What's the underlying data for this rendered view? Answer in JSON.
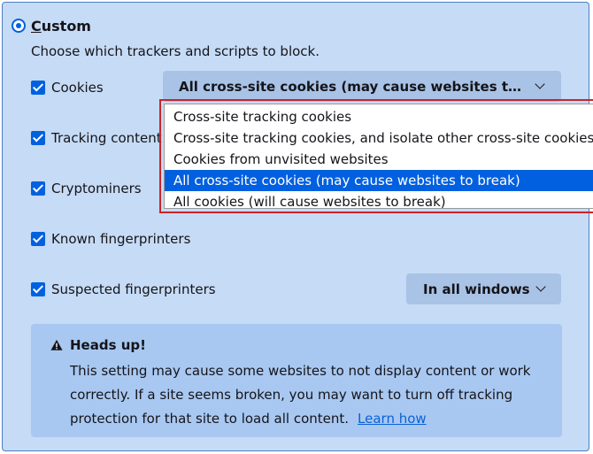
{
  "custom": {
    "title": "Custom",
    "description": "Choose which trackers and scripts to block."
  },
  "rows": [
    {
      "label": "Cookies",
      "checked": true
    },
    {
      "label": "Tracking content",
      "checked": true
    },
    {
      "label": "Cryptominers",
      "checked": true
    },
    {
      "label": "Known fingerprinters",
      "checked": true
    },
    {
      "label": "Suspected fingerprinters",
      "checked": true
    }
  ],
  "cookies_select": {
    "value": "All cross-site cookies (may cause websites t…",
    "options": [
      "Cross-site tracking cookies",
      "Cross-site tracking cookies, and isolate other cross-site cookies",
      "Cookies from unvisited websites",
      "All cross-site cookies (may cause websites to break)",
      "All cookies (will cause websites to break)"
    ],
    "selected_index": 3
  },
  "fingerprinters_select": {
    "value": "In all windows"
  },
  "notice": {
    "title": "Heads up!",
    "body": "This setting may cause some websites to not display content or work correctly. If a site seems broken, you may want to turn off tracking protection for that site to load all content.",
    "link": "Learn how"
  },
  "colors": {
    "panel_bg": "#c6dbf5",
    "accent": "#0061e0",
    "selected_option": "#0060df",
    "highlight_border": "#c9242b",
    "notice_bg": "#a8c8f1"
  },
  "icons": [
    "radio-selected-icon",
    "checkbox-checked-icon",
    "chevron-down-icon",
    "warning-icon"
  ]
}
